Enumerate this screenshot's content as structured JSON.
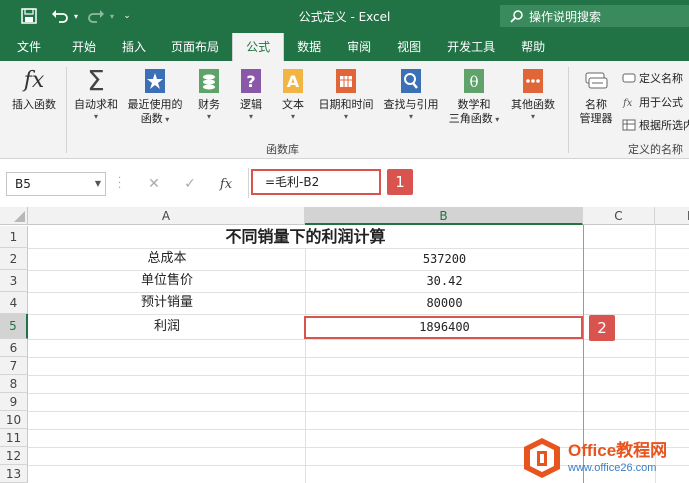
{
  "titlebar": {
    "title": "公式定义 - Excel",
    "tell_me": "操作说明搜索"
  },
  "tabs": [
    {
      "label": "文件",
      "active": false
    },
    {
      "label": "开始",
      "active": false
    },
    {
      "label": "插入",
      "active": false
    },
    {
      "label": "页面布局",
      "active": false
    },
    {
      "label": "公式",
      "active": true
    },
    {
      "label": "数据",
      "active": false
    },
    {
      "label": "审阅",
      "active": false
    },
    {
      "label": "视图",
      "active": false
    },
    {
      "label": "开发工具",
      "active": false
    },
    {
      "label": "帮助",
      "active": false
    }
  ],
  "ribbon": {
    "insert_function": "插入函数",
    "autosum": "自动求和",
    "recent_line1": "最近使用的",
    "recent_line2": "函数",
    "financial": "财务",
    "logical": "逻辑",
    "text": "文本",
    "datetime": "日期和时间",
    "lookup": "查找与引用",
    "math_line1": "数学和",
    "math_line2": "三角函数",
    "more": "其他函数",
    "group_library": "函数库",
    "name_manager_line1": "名称",
    "name_manager_line2": "管理器",
    "define_name": "定义名称",
    "use_in_formula": "用于公式",
    "create_from_selection": "根据所选内",
    "group_defined_names": "定义的名称"
  },
  "formula_bar": {
    "name_box": "B5",
    "formula": "=毛利-B2"
  },
  "badges": {
    "one": "1",
    "two": "2"
  },
  "grid": {
    "columns": [
      "A",
      "B",
      "C",
      "D"
    ],
    "rows": [
      "1",
      "2",
      "3",
      "4",
      "5",
      "6",
      "7",
      "8",
      "9",
      "10",
      "11",
      "12",
      "13"
    ],
    "title": "不同销量下的利润计算",
    "labels": [
      "总成本",
      "单位售价",
      "预计销量",
      "利润"
    ],
    "values": [
      "537200",
      "30.42",
      "80000",
      "1896400"
    ]
  },
  "watermark": {
    "brand": "Office教程网",
    "url": "www.office26.com"
  },
  "colors": {
    "excel_green": "#217346",
    "highlight_red": "#d9534f",
    "watermark_orange": "#e8541e"
  }
}
